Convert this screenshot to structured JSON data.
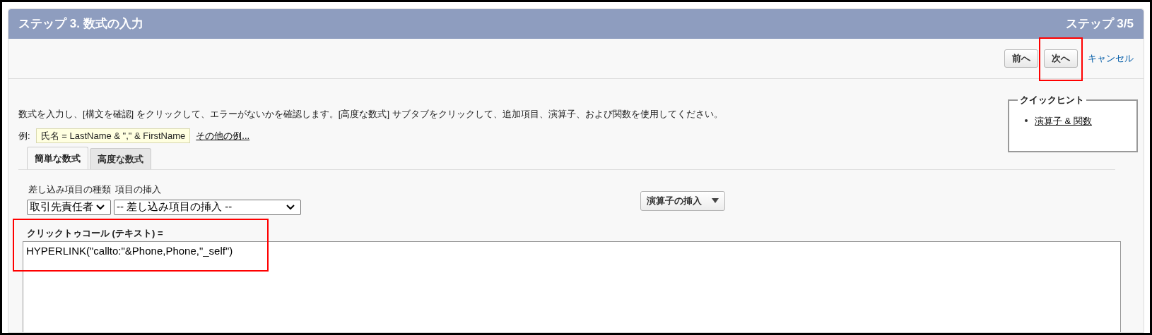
{
  "header": {
    "title": "ステップ 3. 数式の入力",
    "step": "ステップ 3/5"
  },
  "nav": {
    "buttons": [
      {
        "label": "前へ",
        "highlighted": false
      },
      {
        "label": "次へ",
        "highlighted": true
      }
    ],
    "cancel": "キャンセル"
  },
  "instructions": "数式を入力し、[構文を確認] をクリックして、エラーがないかを確認します。[高度な数式] サブタブをクリックして、追加項目、演算子、および関数を使用してください。",
  "example": {
    "label": "例:",
    "formula": "氏名 = LastName & \",\" & FirstName",
    "more_link": "その他の例..."
  },
  "quick_hint": {
    "title": "クイックヒント",
    "links": [
      "演算子 & 関数"
    ]
  },
  "tabs": [
    {
      "label": "簡単な数式",
      "selected": true
    },
    {
      "label": "高度な数式",
      "selected": false
    }
  ],
  "merge_field_type": {
    "label": "差し込み項目の種類",
    "value": "取引先責任者"
  },
  "insert_field": {
    "label": "項目の挿入",
    "value": "-- 差し込み項目の挿入 --"
  },
  "insert_operator": "演算子の挿入",
  "formula": {
    "label": "クリックトゥコール (テキスト) =",
    "value": "HYPERLINK(\"callto:\"&Phone,Phone,\"_self\")",
    "highlighted": true
  }
}
